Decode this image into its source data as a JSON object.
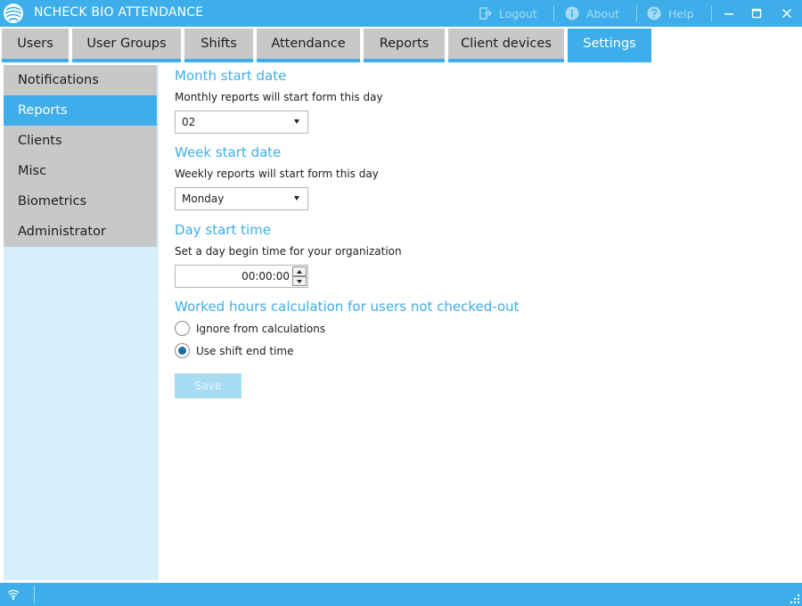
{
  "window": {
    "title": "NCHECK BIO ATTENDANCE",
    "logout_label": "Logout",
    "about_label": "About",
    "help_label": "Help"
  },
  "tabs": [
    {
      "label": "Users"
    },
    {
      "label": "User Groups"
    },
    {
      "label": "Shifts"
    },
    {
      "label": "Attendance"
    },
    {
      "label": "Reports"
    },
    {
      "label": "Client devices"
    },
    {
      "label": "Settings",
      "active": true
    }
  ],
  "sidebar": {
    "items": [
      {
        "label": "Notifications"
      },
      {
        "label": "Reports",
        "active": true
      },
      {
        "label": "Clients"
      },
      {
        "label": "Misc"
      },
      {
        "label": "Biometrics"
      },
      {
        "label": "Administrator"
      }
    ]
  },
  "settings": {
    "month": {
      "title": "Month start date",
      "description": "Monthly reports will start form this day",
      "value": "02"
    },
    "week": {
      "title": "Week start date",
      "description": "Weekly reports will start form this day",
      "value": "Monday"
    },
    "day": {
      "title": "Day start time",
      "description": "Set a day begin time for your organization",
      "value": "00:00:00"
    },
    "worked_hours": {
      "title": "Worked hours calculation for users not checked-out",
      "options": [
        {
          "label": "Ignore from calculations",
          "checked": false
        },
        {
          "label": "Use shift end time",
          "checked": true
        }
      ]
    },
    "save_label": "Save"
  },
  "colors": {
    "accent": "#3daee9",
    "tab_inactive": "#c8c8c8",
    "sidebar_background": "#d6eef9",
    "save_disabled": "#a7dcf3",
    "radio_checked": "#1e6da3"
  },
  "icons": {
    "title": "app-logo-icon",
    "logout": "logout-icon",
    "about": "info-icon",
    "help": "help-icon",
    "minimize": "minimize-icon",
    "maximize": "maximize-icon",
    "close": "close-icon",
    "status": "wifi-icon",
    "resize": "resize-grip-icon"
  }
}
